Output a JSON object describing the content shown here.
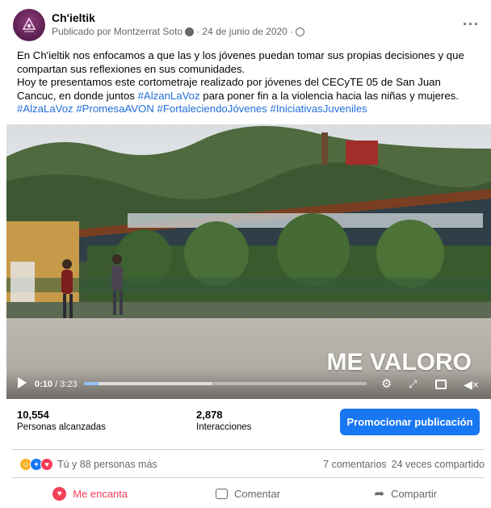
{
  "post": {
    "page_name": "Ch'ieltik",
    "published_by": "Publicado por Montzerrat Soto",
    "date": "· 24 de junio de 2020 ·",
    "more_label": "···",
    "body_line1": "En Ch'ieltik nos enfocamos a que las y los jóvenes puedan tomar sus propias decisiones y que compartan sus reflexiones en sus comunidades.",
    "body_line2a": "Hoy te presentamos este cortometraje realizado por jóvenes del CECyTE 05 de San Juan Cancuc, en donde juntos ",
    "body_tag_inline": "#AlzanLaVoz",
    "body_line2b": " para poner fin a la violencia hacia las niñas y mujeres.",
    "hashtags": [
      "#AlzaLaVoz",
      "#PromesaAVON",
      "#FortaleciendoJóvenes",
      "#IniciativasJuveniles"
    ]
  },
  "video": {
    "overlay_text": "ME VALORO",
    "current_time": "0:10",
    "separator": " / ",
    "duration": "3:23",
    "progress": 0.05,
    "buffered": 0.45
  },
  "stats": {
    "reach_value": "10,554",
    "reach_label": "Personas alcanzadas",
    "interactions_value": "2,878",
    "interactions_label": "Interacciones",
    "promote_label": "Promocionar publicación"
  },
  "reactions": {
    "summary": "Tú y 88 personas más",
    "comments": "7 comentarios",
    "shares": "24 veces compartido"
  },
  "actions": {
    "love": "Me encanta",
    "comment": "Comentar",
    "share": "Compartir"
  },
  "colors": {
    "accent": "#1877f2",
    "love": "#f33e58",
    "link": "#216fdb"
  }
}
